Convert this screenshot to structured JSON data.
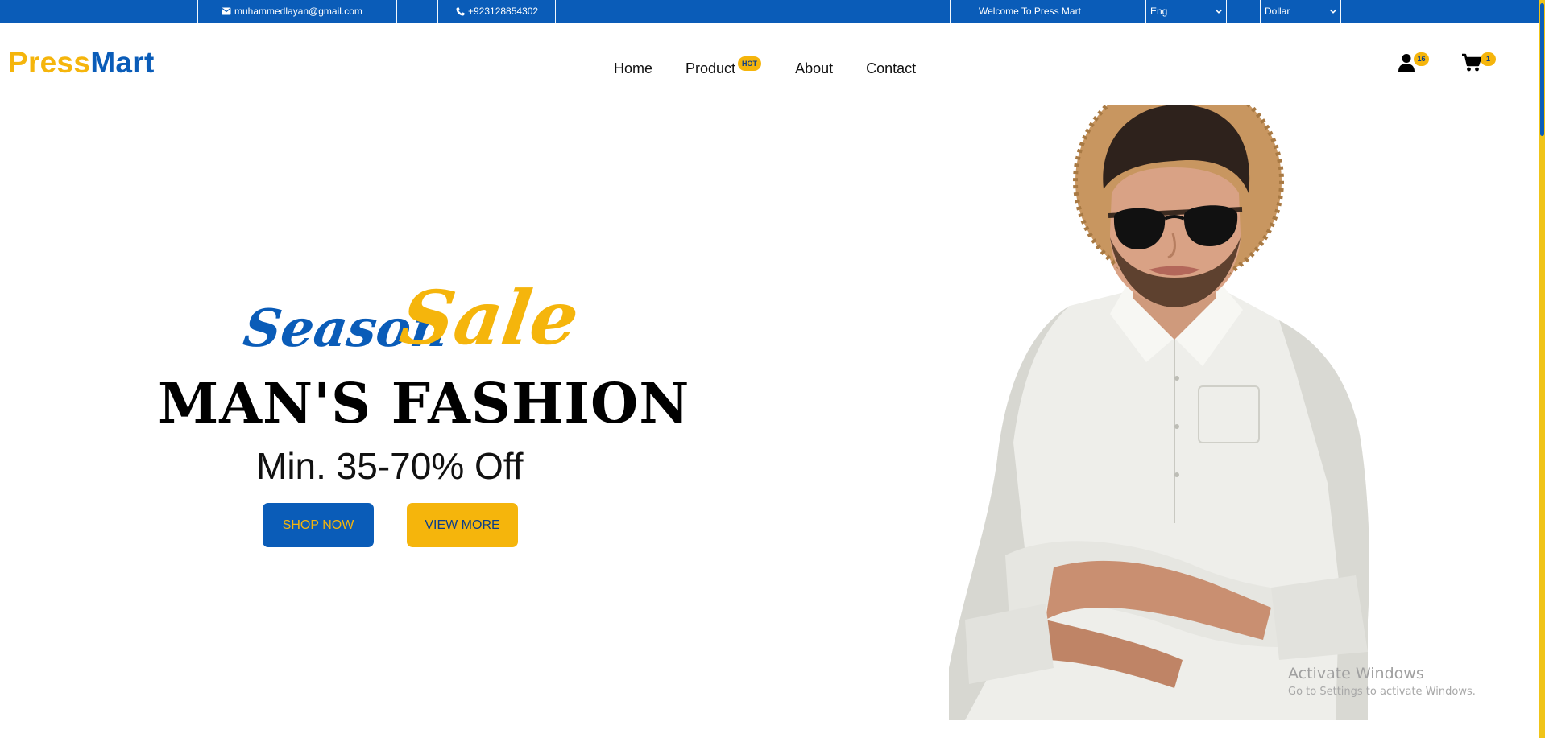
{
  "topbar": {
    "email": "muhammedlayan@gmail.com",
    "phone": "+923128854302",
    "welcome": "Welcome To Press Mart",
    "language": {
      "selected": "Eng"
    },
    "currency": {
      "selected": "Dollar"
    }
  },
  "brand": {
    "logo_part1": "Press",
    "logo_part2": "Mart"
  },
  "nav": {
    "items": [
      {
        "label": "Home"
      },
      {
        "label": "Product",
        "badge": "HOT"
      },
      {
        "label": "About"
      },
      {
        "label": "Contact"
      }
    ]
  },
  "header_icons": {
    "user_count": "16",
    "cart_count": "1"
  },
  "hero": {
    "season": "Season",
    "sale": "Sale",
    "title": "MAN'S FASHION",
    "subtitle": "Min. 35-70% Off",
    "shop_button": "SHOP NOW",
    "view_button": "VIEW MORE",
    "image_icon": "man-model-illustration"
  },
  "watermark": {
    "title": "Activate Windows",
    "subtitle": "Go to Settings to activate Windows."
  },
  "colors": {
    "primary_blue": "#0a5cb8",
    "accent_yellow": "#f5b50c"
  }
}
